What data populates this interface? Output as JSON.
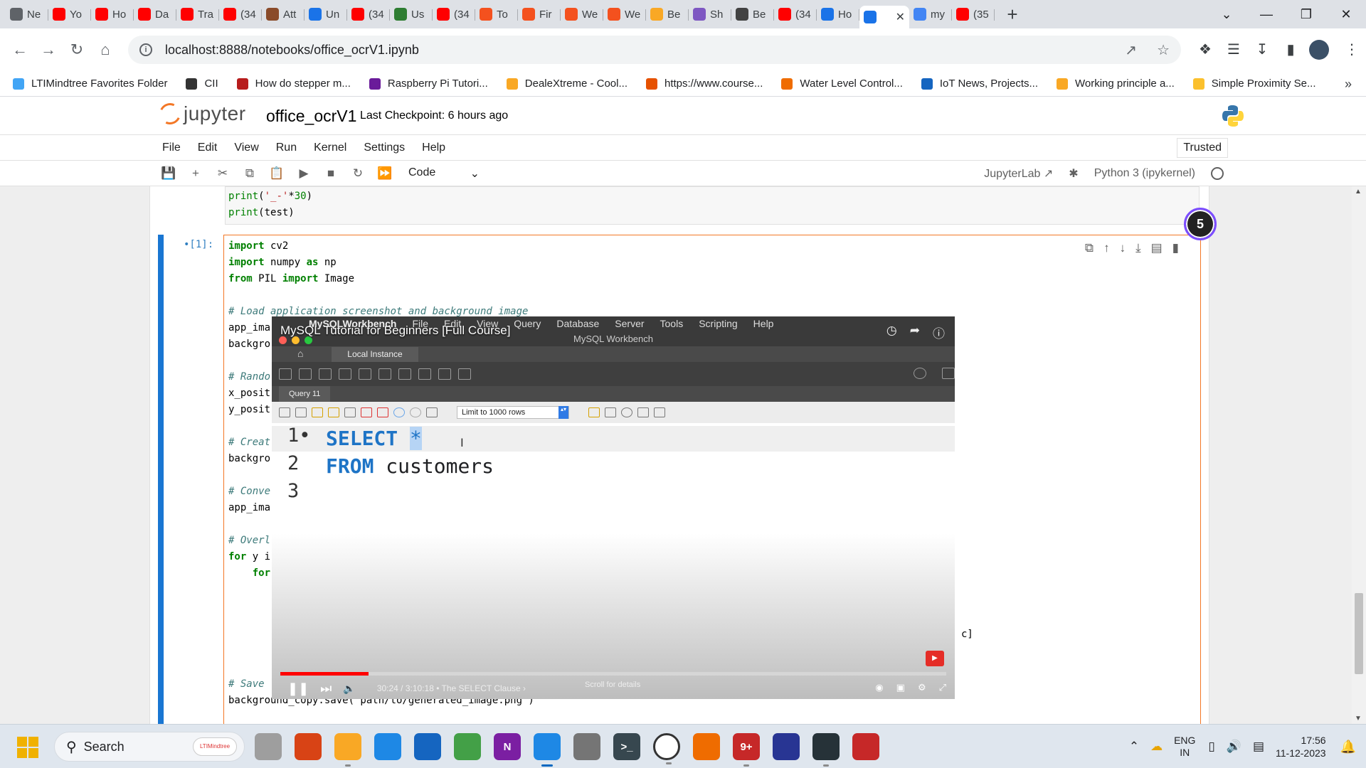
{
  "browser": {
    "tabs": [
      {
        "label": "Ne",
        "color": "#5f6368",
        "icon": "github-icon"
      },
      {
        "label": "Yo",
        "color": "#ff0000",
        "icon": "youtube-icon"
      },
      {
        "label": "Ho",
        "color": "#ff0000",
        "icon": "youtube-icon"
      },
      {
        "label": "Da",
        "color": "#ff0000",
        "icon": "youtube-icon"
      },
      {
        "label": "Tra",
        "color": "#ff0000",
        "icon": "youtube-icon"
      },
      {
        "label": "(34",
        "color": "#ff0000",
        "icon": "youtube-icon"
      },
      {
        "label": "Att",
        "color": "#8a4b2a",
        "icon": "tds-icon"
      },
      {
        "label": "Un",
        "color": "#1a73e8",
        "icon": "chart-icon"
      },
      {
        "label": "(34",
        "color": "#ff0000",
        "icon": "youtube-icon"
      },
      {
        "label": "Us",
        "color": "#2e7d32",
        "icon": "frog-icon"
      },
      {
        "label": "(34",
        "color": "#ff0000",
        "icon": "youtube-icon"
      },
      {
        "label": "To",
        "color": "#f4511e",
        "icon": "c-icon"
      },
      {
        "label": "Fir",
        "color": "#f4511e",
        "icon": "c-icon"
      },
      {
        "label": "We",
        "color": "#f4511e",
        "icon": "c-icon"
      },
      {
        "label": "We",
        "color": "#f4511e",
        "icon": "c-icon"
      },
      {
        "label": "Be",
        "color": "#f9a825",
        "icon": "cookie-icon"
      },
      {
        "label": "Sh",
        "color": "#7e57c2",
        "icon": "spiral-icon"
      },
      {
        "label": "Be",
        "color": "#424242",
        "icon": "gear-icon"
      },
      {
        "label": "(34",
        "color": "#ff0000",
        "icon": "youtube-icon"
      },
      {
        "label": "Ho",
        "color": "#1a73e8",
        "icon": "loading-icon"
      },
      {
        "label": "",
        "color": "#1a73e8",
        "icon": "book-icon",
        "active": true
      },
      {
        "label": "my",
        "color": "#4285f4",
        "icon": "google-icon"
      },
      {
        "label": "(35",
        "color": "#ff0000",
        "icon": "youtube-icon"
      }
    ],
    "new_tab": "+",
    "url": "localhost:8888/notebooks/office_ocrV1.ipynb",
    "bookmarks": [
      {
        "label": "LTIMindtree Favorites Folder",
        "color": "#42a5f5"
      },
      {
        "label": "CII",
        "color": "#333333"
      },
      {
        "label": "How do stepper m...",
        "color": "#b71c1c"
      },
      {
        "label": "Raspberry Pi Tutori...",
        "color": "#6a1b9a"
      },
      {
        "label": "DealeXtreme - Cool...",
        "color": "#f9a825"
      },
      {
        "label": "https://www.course...",
        "color": "#e65100"
      },
      {
        "label": "Water Level Control...",
        "color": "#ef6c00"
      },
      {
        "label": "IoT News, Projects...",
        "color": "#1565c0"
      },
      {
        "label": "Working principle a...",
        "color": "#f9a825"
      },
      {
        "label": "Simple Proximity Se...",
        "color": "#fbc02d"
      }
    ]
  },
  "jupyter": {
    "logo_text": "jupyter",
    "notebook_name": "office_ocrV1",
    "checkpoint": "Last Checkpoint: 6 hours ago",
    "menu": [
      "File",
      "Edit",
      "View",
      "Run",
      "Kernel",
      "Settings",
      "Help"
    ],
    "trusted": "Trusted",
    "cell_type": "Code",
    "jupyterlab_link": "JupyterLab",
    "kernel": "Python 3 (ipykernel)",
    "prompt": "•[1]:",
    "badge": "5",
    "prev_cell_lines": [
      "print('_-'*30)",
      "print(test)"
    ],
    "cell_lines": [
      "import cv2",
      "import numpy as np",
      "from PIL import Image",
      "",
      "# Load application screenshot and background image",
      "app_ima",
      "backgro",
      "",
      "# Rando",
      "x_posit",
      "y_posit",
      "",
      "# Creat",
      "backgro",
      "",
      "# Conve",
      "app_ima",
      "",
      "# Overl",
      "for y i",
      "    for"
    ],
    "tail_fragment": "c]",
    "save_comment": "# Save",
    "save_line": "background_copy.save('path/to/generated_image.png')"
  },
  "video": {
    "title": "MySQL Tutorial for Beginners [Full Course]",
    "mw_menu": [
      "MySQLWorkbench",
      "File",
      "Edit",
      "View",
      "Query",
      "Database",
      "Server",
      "Tools",
      "Scripting",
      "Help"
    ],
    "mw_subtitle": "MySQL Workbench",
    "local_tab": "Local Instance",
    "query_tab": "Query 11",
    "limit": "Limit to 1000 rows",
    "sql": [
      {
        "ln": "1•",
        "kw": "SELECT",
        "rest": "*"
      },
      {
        "ln": "2",
        "kw": "FROM",
        "rest": "customers"
      },
      {
        "ln": "3",
        "kw": "",
        "rest": ""
      }
    ],
    "progress_played": 0.132,
    "time": "30:24 / 3:10:18 • The SELECT Clause ›",
    "scroll_hint": "Scroll for details"
  },
  "taskbar": {
    "search": "Search",
    "search_pill": "LTIMindtree",
    "lang_top": "ENG",
    "lang_bottom": "IN",
    "time": "17:56",
    "date": "11-12-2023",
    "apps": [
      {
        "name": "file-explorer-multitask",
        "color": "#9e9e9e",
        "glyph": ""
      },
      {
        "name": "video-recorder",
        "color": "#d84315",
        "glyph": ""
      },
      {
        "name": "file-explorer",
        "color": "#f9a825",
        "glyph": ""
      },
      {
        "name": "edge",
        "color": "#1e88e5",
        "glyph": ""
      },
      {
        "name": "store",
        "color": "#1565c0",
        "glyph": ""
      },
      {
        "name": "chrome",
        "color": "#43a047",
        "glyph": ""
      },
      {
        "name": "onenote",
        "color": "#7b1fa2",
        "glyph": "N"
      },
      {
        "name": "chrome-active",
        "color": "#1e88e5",
        "glyph": ""
      },
      {
        "name": "settings",
        "color": "#757575",
        "glyph": ""
      },
      {
        "name": "terminal",
        "color": "#37474f",
        "glyph": ">_"
      },
      {
        "name": "clock",
        "color": "#ffffff",
        "glyph": ""
      },
      {
        "name": "office",
        "color": "#ef6c00",
        "glyph": ""
      },
      {
        "name": "calendar-new",
        "color": "#c62828",
        "glyph": "9+"
      },
      {
        "name": "snipping",
        "color": "#283593",
        "glyph": ""
      },
      {
        "name": "obs",
        "color": "#263238",
        "glyph": ""
      },
      {
        "name": "pdf-tool",
        "color": "#c62828",
        "glyph": ""
      }
    ]
  }
}
